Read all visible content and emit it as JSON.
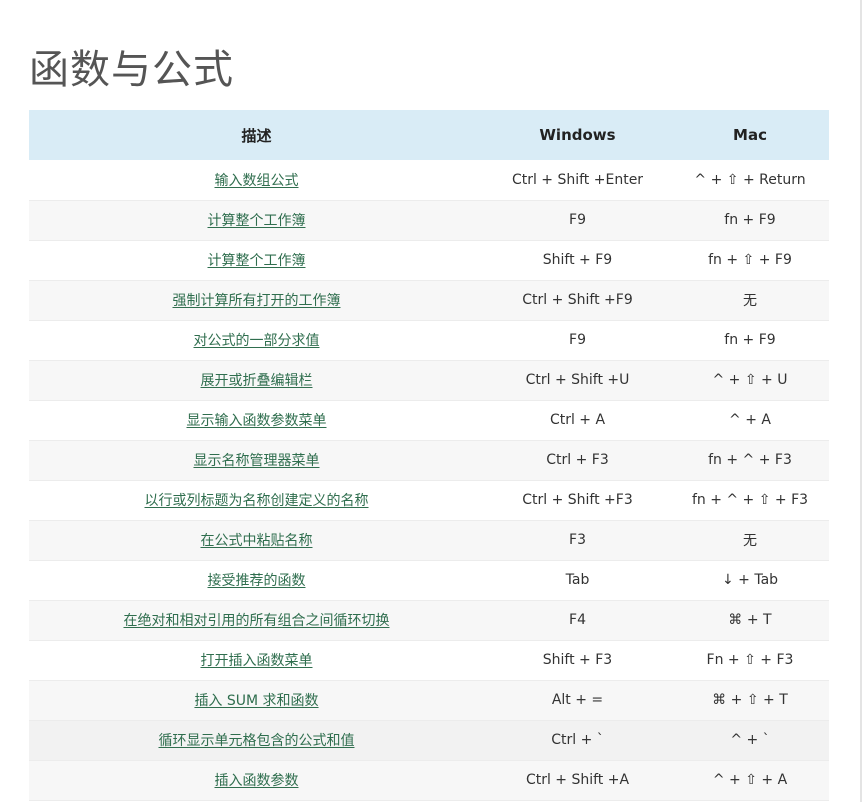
{
  "page": {
    "title": "函数与公式"
  },
  "table": {
    "headers": {
      "description": "描述",
      "windows": "Windows",
      "mac": "Mac"
    },
    "rows": [
      {
        "description": "输入数组公式",
        "windows": "Ctrl + Shift +Enter",
        "mac": "^ + ⇧ + Return"
      },
      {
        "description": "计算整个工作簿",
        "windows": "F9",
        "mac": "fn + F9"
      },
      {
        "description": "计算整个工作簿",
        "windows": "Shift + F9",
        "mac": "fn + ⇧ + F9"
      },
      {
        "description": "强制计算所有打开的工作簿",
        "windows": "Ctrl + Shift +F9",
        "mac": "无"
      },
      {
        "description": "对公式的一部分求值",
        "windows": "F9",
        "mac": "fn + F9"
      },
      {
        "description": "展开或折叠编辑栏",
        "windows": "Ctrl + Shift +U",
        "mac": "^ + ⇧ + U"
      },
      {
        "description": "显示输入函数参数菜单",
        "windows": "Ctrl + A",
        "mac": "^ + A"
      },
      {
        "description": "显示名称管理器菜单",
        "windows": "Ctrl + F3",
        "mac": "fn + ^ + F3"
      },
      {
        "description": "以行或列标题为名称创建定义的名称",
        "windows": "Ctrl + Shift +F3",
        "mac": "fn + ^ + ⇧ + F3"
      },
      {
        "description": "在公式中粘贴名称",
        "windows": "F3",
        "mac": "无"
      },
      {
        "description": "接受推荐的函数",
        "windows": "Tab",
        "mac": "↓ + Tab"
      },
      {
        "description": "在绝对和相对引用的所有组合之间循环切换",
        "windows": "F4",
        "mac": "⌘ + T"
      },
      {
        "description": "打开插入函数菜单",
        "windows": "Shift + F3",
        "mac": "Fn + ⇧ + F3"
      },
      {
        "description": "插入 SUM 求和函数",
        "windows": "Alt + =",
        "mac": "⌘ + ⇧ + T"
      },
      {
        "description": "循环显示单元格包含的公式和值",
        "windows": "Ctrl + `",
        "mac": "^ + `"
      },
      {
        "description": "插入函数参数",
        "windows": "Ctrl + Shift +A",
        "mac": "^ + ⇧ + A"
      }
    ]
  }
}
